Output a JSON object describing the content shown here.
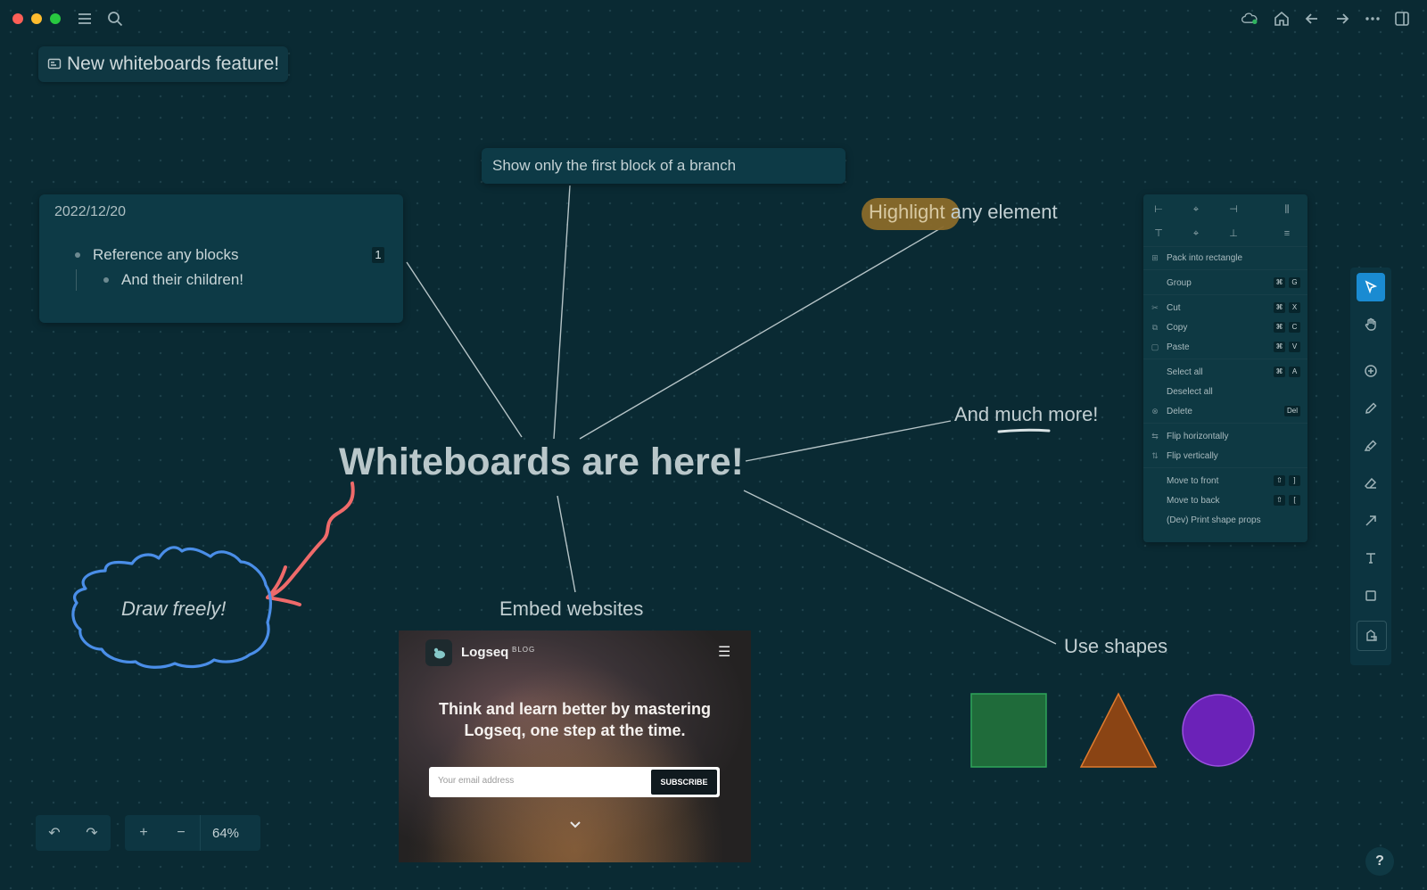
{
  "window": {
    "page_title": "New whiteboards feature!"
  },
  "blocks_card": {
    "date": "2022/12/20",
    "item1": "Reference any blocks",
    "item1_ref_count": "1",
    "item2": "And their children!"
  },
  "branch_card": {
    "text": "Show only the first block of a branch"
  },
  "canvas": {
    "main_title": "Whiteboards are here!",
    "highlight_word": "Highlight",
    "highlight_rest": " any element",
    "much_prefix": "And ",
    "much_word": "much",
    "much_suffix": " more!",
    "draw_label": "Draw freely!",
    "embed_label": "Embed websites",
    "shapes_label": "Use shapes"
  },
  "context_menu": {
    "items": [
      {
        "label": "Pack into rectangle",
        "keys": []
      },
      {
        "label": "Group",
        "keys": [
          "⌘",
          "G"
        ]
      },
      {
        "label": "Cut",
        "keys": [
          "⌘",
          "X"
        ]
      },
      {
        "label": "Copy",
        "keys": [
          "⌘",
          "C"
        ]
      },
      {
        "label": "Paste",
        "keys": [
          "⌘",
          "V"
        ]
      },
      {
        "label": "Select all",
        "keys": [
          "⌘",
          "A"
        ]
      },
      {
        "label": "Deselect all",
        "keys": []
      },
      {
        "label": "Delete",
        "keys": [
          "Del"
        ]
      },
      {
        "label": "Flip horizontally",
        "keys": []
      },
      {
        "label": "Flip vertically",
        "keys": []
      },
      {
        "label": "Move to front",
        "keys": [
          "⇧",
          "]"
        ]
      },
      {
        "label": "Move to back",
        "keys": [
          "⇧",
          "["
        ]
      },
      {
        "label": "(Dev) Print shape props",
        "keys": []
      }
    ]
  },
  "embed": {
    "brand": "Logseq",
    "blog_tag": "BLOG",
    "headline": "Think and learn better by mastering Logseq, one step at the time.",
    "email_placeholder": "Your email address",
    "subscribe": "SUBSCRIBE"
  },
  "controls": {
    "undo": "↶",
    "redo": "↷",
    "zoom_in": "+",
    "zoom_out": "−",
    "zoom": "64%",
    "help": "?"
  },
  "shapes": {
    "square_color": "#1f6b3a",
    "triangle_color": "#8a4414",
    "circle_color": "#6b22b8"
  },
  "colors": {
    "background": "#0a2a33",
    "accent": "#1a8bd2",
    "pen_blue": "#4a8ee8",
    "pen_red": "#ef6a6a"
  }
}
